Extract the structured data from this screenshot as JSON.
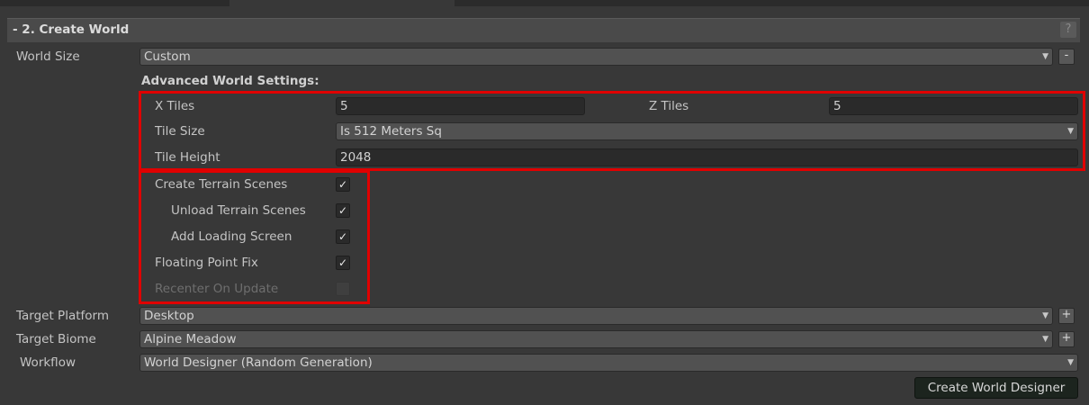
{
  "section": {
    "title": "- 2. Create World",
    "help": "?"
  },
  "world_size": {
    "label": "World Size",
    "value": "Custom",
    "button": "-"
  },
  "advanced": {
    "heading": "Advanced World Settings:",
    "x_tiles": {
      "label": "X Tiles",
      "value": "5"
    },
    "z_tiles": {
      "label": "Z Tiles",
      "value": "5"
    },
    "tile_size": {
      "label": "Tile Size",
      "value": "Is 512 Meters Sq"
    },
    "tile_height": {
      "label": "Tile Height",
      "value": "2048"
    }
  },
  "options": {
    "create_terrain_scenes": {
      "label": "Create Terrain Scenes",
      "checked": true
    },
    "unload_terrain_scenes": {
      "label": "Unload Terrain Scenes",
      "checked": true
    },
    "add_loading_screen": {
      "label": "Add Loading Screen",
      "checked": true
    },
    "floating_point_fix": {
      "label": "Floating Point Fix",
      "checked": true
    },
    "recenter_on_update": {
      "label": "Recenter On Update",
      "checked": false,
      "disabled": true
    }
  },
  "target_platform": {
    "label": "Target Platform",
    "value": "Desktop",
    "button": "+"
  },
  "target_biome": {
    "label": "Target Biome",
    "value": "Alpine Meadow",
    "button": "+"
  },
  "workflow": {
    "label": "Workflow",
    "value": "World Designer (Random Generation)"
  },
  "create_button": "Create World Designer",
  "colors": {
    "highlight": "#e00000",
    "panel": "#383838",
    "header": "#4a4a4a"
  },
  "icons": {
    "dropdown": "triangle-down-icon",
    "check": "checkmark-icon"
  }
}
